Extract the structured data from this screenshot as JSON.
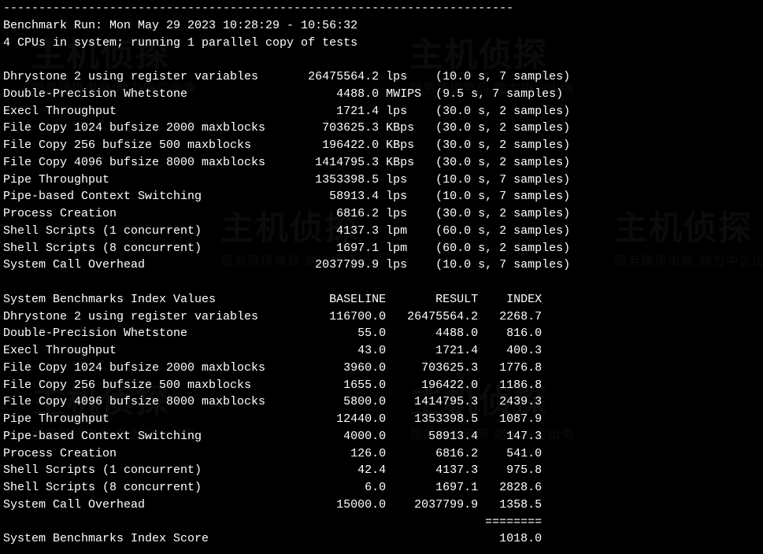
{
  "divider": "------------------------------------------------------------------------",
  "header": {
    "run_line": "Benchmark Run: Mon May 29 2023 10:28:29 - 10:56:32",
    "cpu_line": "4 CPUs in system; running 1 parallel copy of tests"
  },
  "results": [
    {
      "name": "Dhrystone 2 using register variables",
      "value": "26475564.2",
      "unit": "lps",
      "timing": "(10.0 s, 7 samples)"
    },
    {
      "name": "Double-Precision Whetstone",
      "value": "4488.0",
      "unit": "MWIPS",
      "timing": "(9.5 s, 7 samples)"
    },
    {
      "name": "Execl Throughput",
      "value": "1721.4",
      "unit": "lps",
      "timing": "(30.0 s, 2 samples)"
    },
    {
      "name": "File Copy 1024 bufsize 2000 maxblocks",
      "value": "703625.3",
      "unit": "KBps",
      "timing": "(30.0 s, 2 samples)"
    },
    {
      "name": "File Copy 256 bufsize 500 maxblocks",
      "value": "196422.0",
      "unit": "KBps",
      "timing": "(30.0 s, 2 samples)"
    },
    {
      "name": "File Copy 4096 bufsize 8000 maxblocks",
      "value": "1414795.3",
      "unit": "KBps",
      "timing": "(30.0 s, 2 samples)"
    },
    {
      "name": "Pipe Throughput",
      "value": "1353398.5",
      "unit": "lps",
      "timing": "(10.0 s, 7 samples)"
    },
    {
      "name": "Pipe-based Context Switching",
      "value": "58913.4",
      "unit": "lps",
      "timing": "(10.0 s, 7 samples)"
    },
    {
      "name": "Process Creation",
      "value": "6816.2",
      "unit": "lps",
      "timing": "(30.0 s, 2 samples)"
    },
    {
      "name": "Shell Scripts (1 concurrent)",
      "value": "4137.3",
      "unit": "lpm",
      "timing": "(60.0 s, 2 samples)"
    },
    {
      "name": "Shell Scripts (8 concurrent)",
      "value": "1697.1",
      "unit": "lpm",
      "timing": "(60.0 s, 2 samples)"
    },
    {
      "name": "System Call Overhead",
      "value": "2037799.9",
      "unit": "lps",
      "timing": "(10.0 s, 7 samples)"
    }
  ],
  "index_header": {
    "title": "System Benchmarks Index Values",
    "col_baseline": "BASELINE",
    "col_result": "RESULT",
    "col_index": "INDEX"
  },
  "index_rows": [
    {
      "name": "Dhrystone 2 using register variables",
      "baseline": "116700.0",
      "result": "26475564.2",
      "index": "2268.7"
    },
    {
      "name": "Double-Precision Whetstone",
      "baseline": "55.0",
      "result": "4488.0",
      "index": "816.0"
    },
    {
      "name": "Execl Throughput",
      "baseline": "43.0",
      "result": "1721.4",
      "index": "400.3"
    },
    {
      "name": "File Copy 1024 bufsize 2000 maxblocks",
      "baseline": "3960.0",
      "result": "703625.3",
      "index": "1776.8"
    },
    {
      "name": "File Copy 256 bufsize 500 maxblocks",
      "baseline": "1655.0",
      "result": "196422.0",
      "index": "1186.8"
    },
    {
      "name": "File Copy 4096 bufsize 8000 maxblocks",
      "baseline": "5800.0",
      "result": "1414795.3",
      "index": "2439.3"
    },
    {
      "name": "Pipe Throughput",
      "baseline": "12440.0",
      "result": "1353398.5",
      "index": "1087.9"
    },
    {
      "name": "Pipe-based Context Switching",
      "baseline": "4000.0",
      "result": "58913.4",
      "index": "147.3"
    },
    {
      "name": "Process Creation",
      "baseline": "126.0",
      "result": "6816.2",
      "index": "541.0"
    },
    {
      "name": "Shell Scripts (1 concurrent)",
      "baseline": "42.4",
      "result": "4137.3",
      "index": "975.8"
    },
    {
      "name": "Shell Scripts (8 concurrent)",
      "baseline": "6.0",
      "result": "1697.1",
      "index": "2828.6"
    },
    {
      "name": "System Call Overhead",
      "baseline": "15000.0",
      "result": "2037799.9",
      "index": "1358.5"
    }
  ],
  "score": {
    "separator": "========",
    "label": "System Benchmarks Index Score",
    "value": "1018.0"
  },
  "watermark": {
    "main": "主机侦探",
    "sub": "服务跨境电商 助力中企出海"
  }
}
